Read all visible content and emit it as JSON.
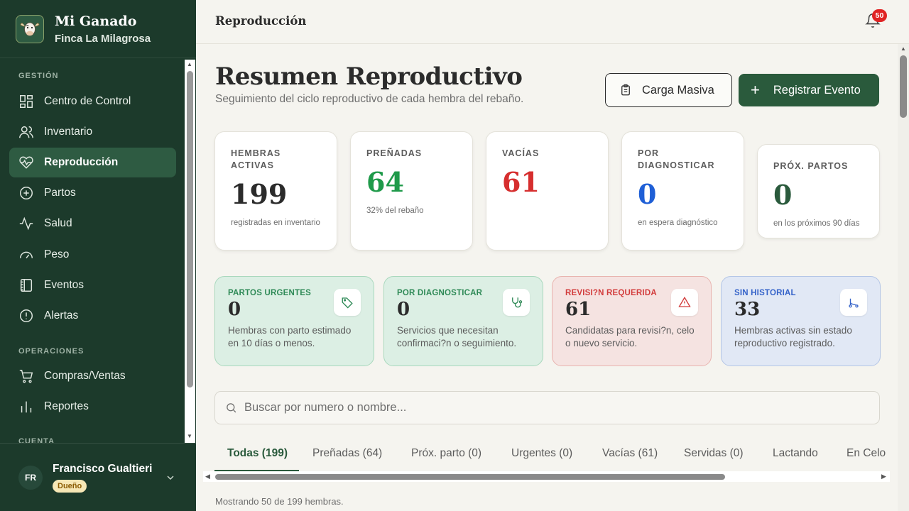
{
  "brand": {
    "title": "Mi Ganado",
    "farm": "Finca La Milagrosa"
  },
  "sidebar": {
    "sections": [
      "GESTIÓN",
      "OPERACIONES",
      "CUENTA"
    ],
    "items": [
      {
        "label": "Centro de Control",
        "icon": "grid-icon"
      },
      {
        "label": "Inventario",
        "icon": "users-icon"
      },
      {
        "label": "Reproducción",
        "icon": "heart-pulse-icon",
        "active": true
      },
      {
        "label": "Partos",
        "icon": "plus-circle-icon"
      },
      {
        "label": "Salud",
        "icon": "activity-icon"
      },
      {
        "label": "Peso",
        "icon": "gauge-icon"
      },
      {
        "label": "Eventos",
        "icon": "notebook-icon"
      },
      {
        "label": "Alertas",
        "icon": "alert-circle-icon"
      },
      {
        "label": "Compras/Ventas",
        "icon": "cart-icon"
      },
      {
        "label": "Reportes",
        "icon": "bar-chart-icon"
      }
    ]
  },
  "user": {
    "initials": "FR",
    "name": "Francisco Gualtieri",
    "role": "Dueño"
  },
  "topbar": {
    "title": "Reproducción",
    "notifications": "50"
  },
  "page": {
    "title": "Resumen Reproductivo",
    "subtitle": "Seguimiento del ciclo reproductivo de cada hembra del rebaño.",
    "bulk_label": "Carga Masiva",
    "register_label": "Registrar Evento",
    "plus": "+"
  },
  "stats": [
    {
      "label": "Hembras Activas",
      "value": "199",
      "note": "registradas en inventario",
      "color": "#2b2b2b"
    },
    {
      "label": "Preñadas",
      "value": "64",
      "note": "32% del rebaño",
      "color": "#1f9a4a"
    },
    {
      "label": "Vacías",
      "value": "61",
      "note": "",
      "color": "#d62e2e"
    },
    {
      "label": "Por Diagnosticar",
      "value": "0",
      "note": "en espera diagnóstico",
      "color": "#1f5fd6"
    },
    {
      "label": "Próx. Partos",
      "value": "0",
      "note": "en los próximos 90 días",
      "color": "#2a5a3c"
    }
  ],
  "alerts": [
    {
      "label": "PARTOS URGENTES",
      "value": "0",
      "desc": "Hembras con parto estimado en 10 días o menos.",
      "icon": "tag-icon",
      "color": "#2f8a57"
    },
    {
      "label": "POR DIAGNOSTICAR",
      "value": "0",
      "desc": "Servicios que necesitan confirmaci?n o seguimiento.",
      "icon": "stethoscope-icon",
      "color": "#2f8a57"
    },
    {
      "label": "REVISI?N REQUERIDA",
      "value": "61",
      "desc": "Candidatas para revisi?n, celo o nuevo servicio.",
      "icon": "warning-icon",
      "color": "#d23c3c"
    },
    {
      "label": "SIN HISTORIAL",
      "value": "33",
      "desc": "Hembras activas sin estado reproductivo registrado.",
      "icon": "route-icon",
      "color": "#3563c9"
    }
  ],
  "search": {
    "placeholder": "Buscar por numero o nombre...",
    "value": ""
  },
  "tabs": [
    "Todas (199)",
    "Preñadas (64)",
    "Próx. parto (0)",
    "Urgentes (0)",
    "Vacías (61)",
    "Servidas (0)",
    "Lactando",
    "En Celo"
  ],
  "footer": {
    "showing": "Mostrando 50 de 199 hembras."
  },
  "colors": {
    "sidebar": "#1c3a2b",
    "accent": "#2a5a3c",
    "background": "#f5f4ef"
  }
}
